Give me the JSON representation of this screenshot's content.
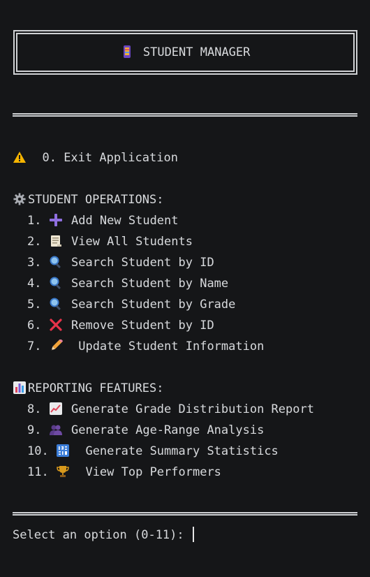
{
  "header": {
    "title": "STUDENT MANAGER",
    "icon": "phone-icon"
  },
  "exit": {
    "icon": "warning-icon",
    "label": "0. Exit Application"
  },
  "student_ops": {
    "icon": "gear-icon",
    "heading": "STUDENT OPERATIONS:",
    "items": [
      {
        "num": "1.",
        "icon": "plus-icon",
        "label": "Add New Student"
      },
      {
        "num": "2.",
        "icon": "scroll-icon",
        "label": "View All Students"
      },
      {
        "num": "3.",
        "icon": "magnifier-icon",
        "label": "Search Student by ID"
      },
      {
        "num": "4.",
        "icon": "magnifier-icon",
        "label": "Search Student by Name"
      },
      {
        "num": "5.",
        "icon": "magnifier-icon",
        "label": "Search Student by Grade"
      },
      {
        "num": "6.",
        "icon": "cross-icon",
        "label": "Remove Student by ID"
      },
      {
        "num": "7.",
        "icon": "pencil-icon",
        "label": " Update Student Information"
      }
    ]
  },
  "reporting": {
    "icon": "bar-chart-icon",
    "heading": "REPORTING FEATURES:",
    "items": [
      {
        "num": "8.",
        "icon": "chart-up-icon",
        "label": "Generate Grade Distribution Report"
      },
      {
        "num": "9.",
        "icon": "people-icon",
        "label": "Generate Age-Range Analysis"
      },
      {
        "num": "10.",
        "icon": "numbers-icon",
        "label": " Generate Summary Statistics"
      },
      {
        "num": "11.",
        "icon": "trophy-icon",
        "label": " View Top Performers"
      }
    ]
  },
  "prompt": {
    "text": "Select an option (0-11): "
  },
  "colors": {
    "background": "#151618",
    "text": "#d8dadd",
    "border": "#cfd1d4"
  }
}
